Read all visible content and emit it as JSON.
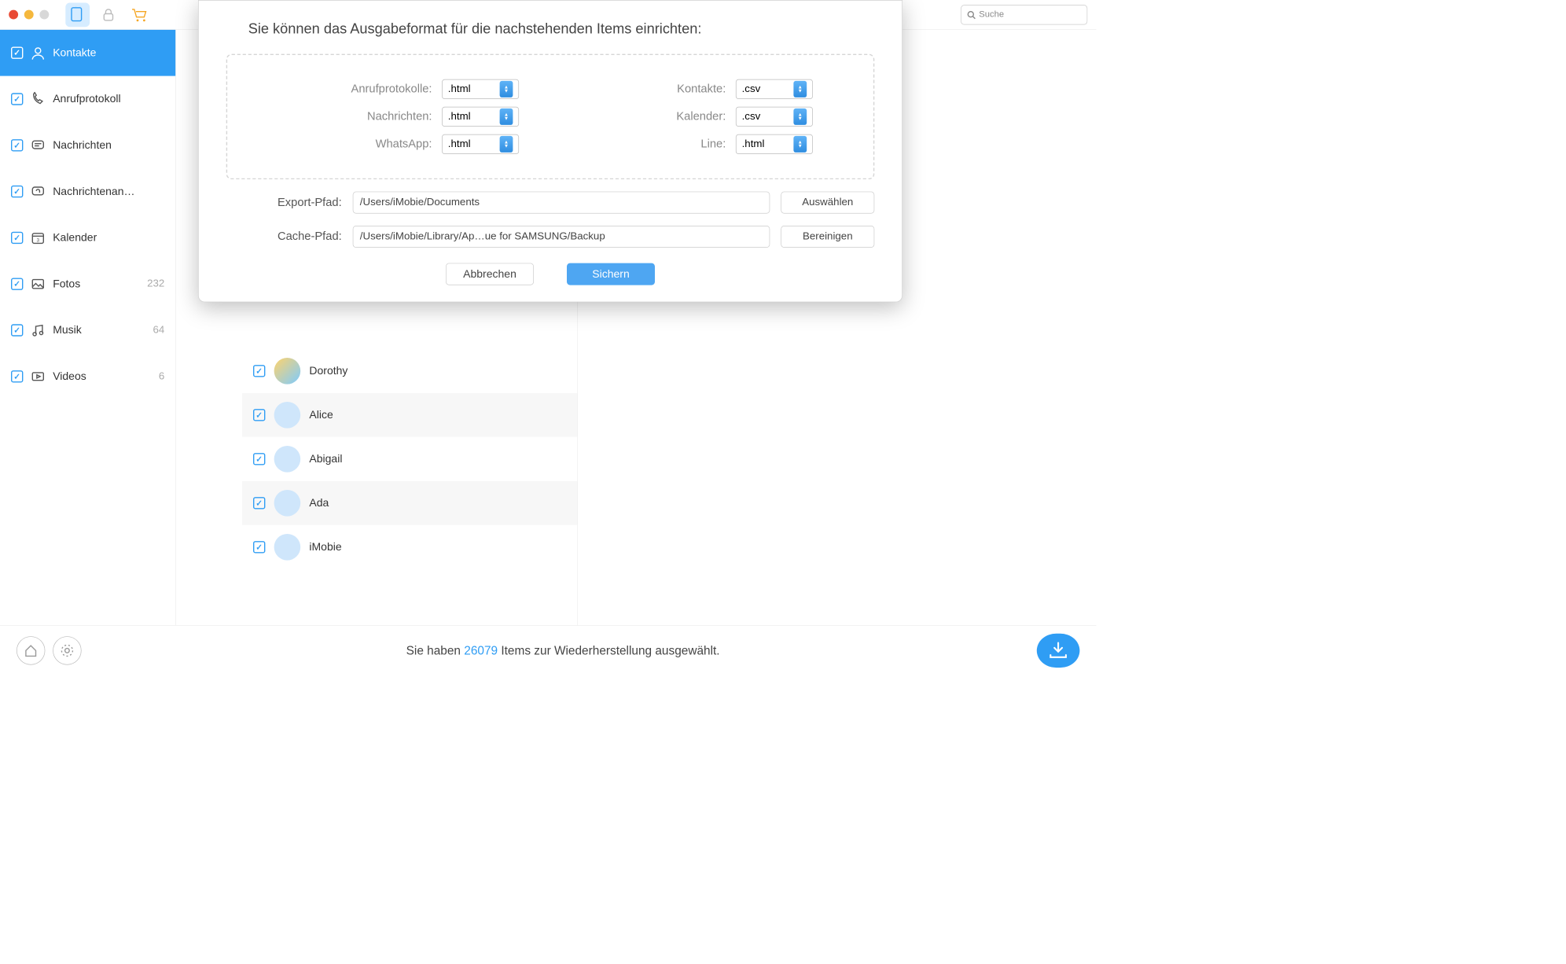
{
  "search_placeholder": "Suche",
  "sidebar": [
    {
      "label": "Kontakte",
      "count": ""
    },
    {
      "label": "Anrufprotokoll",
      "count": ""
    },
    {
      "label": "Nachrichten",
      "count": ""
    },
    {
      "label": "Nachrichtenan…",
      "count": ""
    },
    {
      "label": "Kalender",
      "count": ""
    },
    {
      "label": "Fotos",
      "count": "232"
    },
    {
      "label": "Musik",
      "count": "64"
    },
    {
      "label": "Videos",
      "count": "6"
    }
  ],
  "contacts": [
    {
      "name": "Dorothy"
    },
    {
      "name": "Alice"
    },
    {
      "name": "Abigail"
    },
    {
      "name": "Ada"
    },
    {
      "name": "iMobie"
    }
  ],
  "modal": {
    "title": "Sie können das Ausgabeformat für die nachstehenden Items einrichten:",
    "formats": {
      "anrufprotokolle_label": "Anrufprotokolle:",
      "anrufprotokolle_value": ".html",
      "kontakte_label": "Kontakte:",
      "kontakte_value": ".csv",
      "nachrichten_label": "Nachrichten:",
      "nachrichten_value": ".html",
      "kalender_label": "Kalender:",
      "kalender_value": ".csv",
      "whatsapp_label": "WhatsApp:",
      "whatsapp_value": ".html",
      "line_label": "Line:",
      "line_value": ".html"
    },
    "export_path_label": "Export-Pfad:",
    "export_path_value": "/Users/iMobie/Documents",
    "export_choose": "Auswählen",
    "cache_path_label": "Cache-Pfad:",
    "cache_path_value": "/Users/iMobie/Library/Ap…ue for SAMSUNG/Backup",
    "cache_clean": "Bereinigen",
    "cancel": "Abbrechen",
    "save": "Sichern"
  },
  "footer": {
    "pre": "Sie haben ",
    "count": "26079",
    "post": " Items zur Wiederherstellung ausgewählt."
  }
}
